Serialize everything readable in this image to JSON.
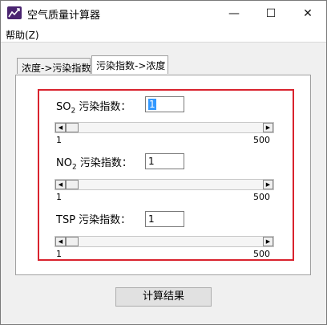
{
  "window": {
    "title": "空气质量计算器",
    "controls": {
      "minimize": "—",
      "maximize": "☐",
      "close": "✕"
    }
  },
  "menu": {
    "help": "帮助(Z)"
  },
  "tabs": [
    {
      "label": "浓度->污染指数"
    },
    {
      "label": "污染指数->浓度"
    }
  ],
  "fields": [
    {
      "name_main": "SO",
      "name_sub": "2",
      "name_suffix": " 污染指数：",
      "value": "1",
      "slider_min": "1",
      "slider_max": "500",
      "slider_position": 0
    },
    {
      "name_main": "NO",
      "name_sub": "2",
      "name_suffix": " 污染指数：",
      "value": "1",
      "slider_min": "1",
      "slider_max": "500",
      "slider_position": 0
    },
    {
      "name_main": "TSP 污染指数：",
      "name_sub": "",
      "name_suffix": "",
      "value": "1",
      "slider_min": "1",
      "slider_max": "500",
      "slider_position": 0
    }
  ],
  "buttons": {
    "calculate": "计算结果"
  },
  "colors": {
    "highlight_border": "#d9232e",
    "selection": "#3399ff"
  },
  "icons": {
    "app": "chart-line-icon",
    "scroll_left": "triangle-left",
    "scroll_right": "triangle-right"
  }
}
